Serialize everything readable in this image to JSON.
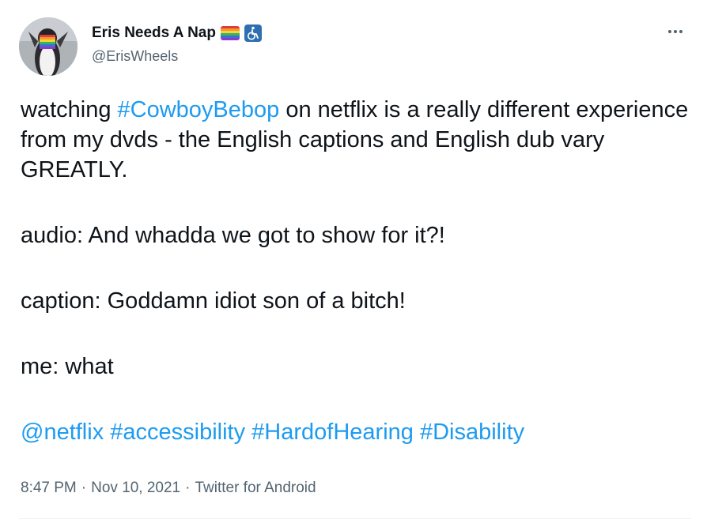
{
  "author": {
    "display_name": "Eris Needs A Nap",
    "handle": "@ErisWheels",
    "badges": [
      "rainbow-flag-icon",
      "wheelchair-icon"
    ]
  },
  "tweet": {
    "line1_pre": "watching ",
    "hashtag_cowboybebop": "#CowboyBebop",
    "line1_post": " on netflix is a really different experience from my dvds - the English captions and English dub vary GREATLY.",
    "audio_line": "audio: And whadda we got to show for it?!",
    "caption_line": "caption: Goddamn idiot son of a bitch!",
    "me_line": "me: what",
    "mention_netflix": "@netflix",
    "hashtag_accessibility": "#accessibility",
    "hashtag_hardofhearing": "#HardofHearing",
    "hashtag_disability": "#Disability"
  },
  "meta": {
    "time": "8:47 PM",
    "sep1": "·",
    "date": "Nov 10, 2021",
    "sep2": "·",
    "source": "Twitter for Android"
  },
  "colors": {
    "link": "#1d9bf0",
    "text": "#0f1419",
    "secondary": "#536471"
  }
}
